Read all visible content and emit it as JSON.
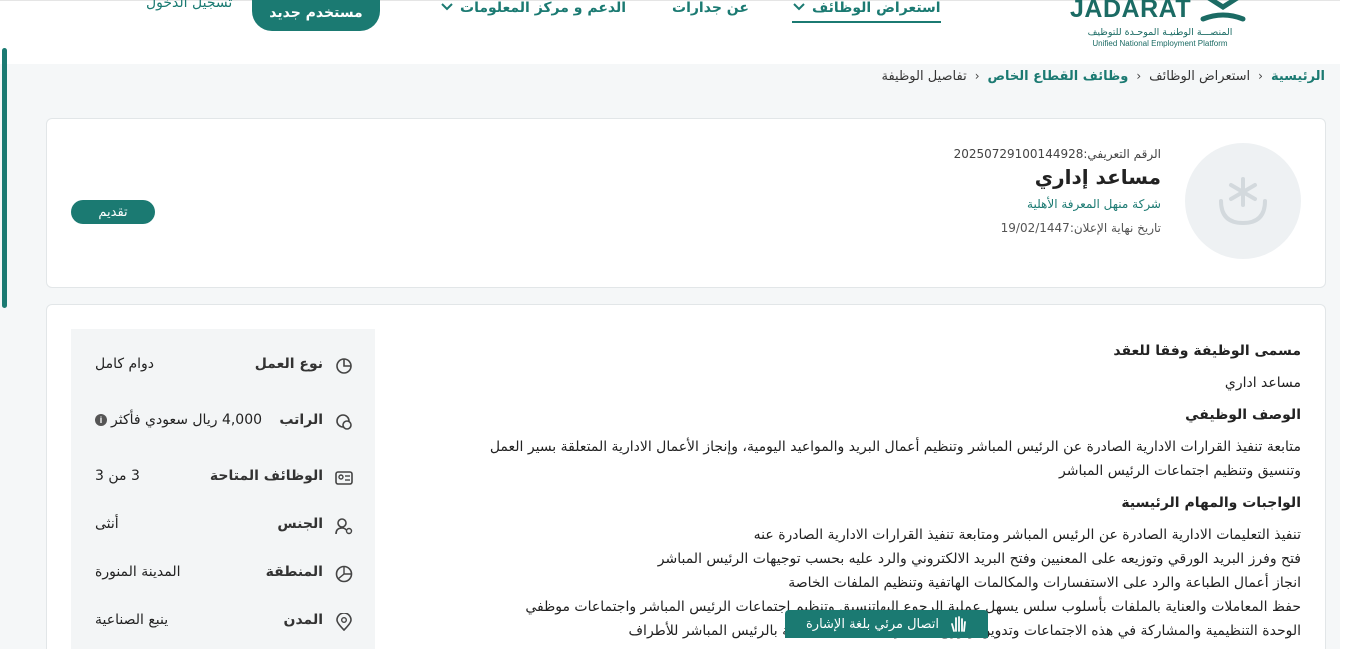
{
  "header": {
    "logo_text": "JADARAT",
    "logo_subtitle_ar": "المنصـــة الوطنيـة الموحـدة للتوظيف",
    "logo_subtitle_en": "Unified National Employment Platform",
    "nav": {
      "browse_jobs": "استعراض الوظائف",
      "about": "عن جدارات",
      "support": "الدعم و مركز المعلومات"
    },
    "register_label": "مستخدم جديد",
    "login_label": "تسجيل الدخول"
  },
  "breadcrumb": {
    "home": "الرئيسية",
    "browse": "استعراض الوظائف",
    "private_sector": "وظائف القطاع الخاص",
    "current": "تفاصيل الوظيفة"
  },
  "job": {
    "id_label": "الرقم التعريفي:",
    "id_value": "20250729100144928",
    "title": "مساعد إداري",
    "company": "شركة منهل المعرفة الأهلية",
    "deadline_label": "تاريخ نهاية الإعلان:",
    "deadline_value": "19/02/1447",
    "apply_label": "تقديم"
  },
  "attributes": [
    {
      "icon": "pie-chart-icon",
      "label": "نوع العمل",
      "value": "دوام كامل"
    },
    {
      "icon": "money-icon",
      "label": "الراتب",
      "value": "4,000 ريال سعودي فأكثر"
    },
    {
      "icon": "id-card-icon",
      "label": "الوظائف المتاحة",
      "value": "3 من 3"
    },
    {
      "icon": "gender-icon",
      "label": "الجنس",
      "value": "أنثى"
    },
    {
      "icon": "region-map-icon",
      "label": "المنطقة",
      "value": "المدينة المنورة"
    },
    {
      "icon": "location-pin-icon",
      "label": "المدن",
      "value": "ينبع الصناعية"
    }
  ],
  "details": {
    "contract_title_heading": "مسمى الوظيفة وفقا للعقد",
    "contract_title_value": "مساعد اداري",
    "description_heading": "الوصف الوظيفي",
    "description_lines": [
      "متابعة تنفيذ القرارات الادارية الصادرة عن الرئيس المباشر وتنظيم أعمال البريد والمواعيد اليومية، وإنجاز الأعمال الادارية المتعلقة بسير العمل",
      "وتنسيق وتنظيم اجتماعات الرئيس المباشر"
    ],
    "duties_heading": "الواجبات والمهام الرئيسية",
    "duties_lines": [
      "تنفيذ التعليمات الادارية الصادرة عن الرئيس المباشر ومتابعة تنفيذ القرارات الادارية الصادرة عنه",
      "فتح وفرز البريد الورقي وتوزيعه على المعنيين وفتح البريد الالكتروني والرد عليه بحسب توجيهات الرئيس المباشر",
      "انجاز أعمال الطباعة والرد على الاستفسارات والمكالمات الهاتفية وتنظيم الملفات الخاصة",
      "حفظ المعاملات والعناية بالملفات بأسلوب سلس يسهل عملية الرجوع اليهاتنسيق وتنظيم اجتماعات الرئيس المباشر واجتماعات موظفي",
      "الوحدة التنظيمية والمشاركة في هذه الاجتماعات وتدوين وتوزيع محاضر الاجتماعات الخاصة بالرئيس المباشر للأطراف"
    ]
  },
  "sign_language_label": "اتصال مرئي بلغة الإشارة",
  "colors": {
    "primary": "#1b7a72",
    "background": "#f5f7f8"
  }
}
